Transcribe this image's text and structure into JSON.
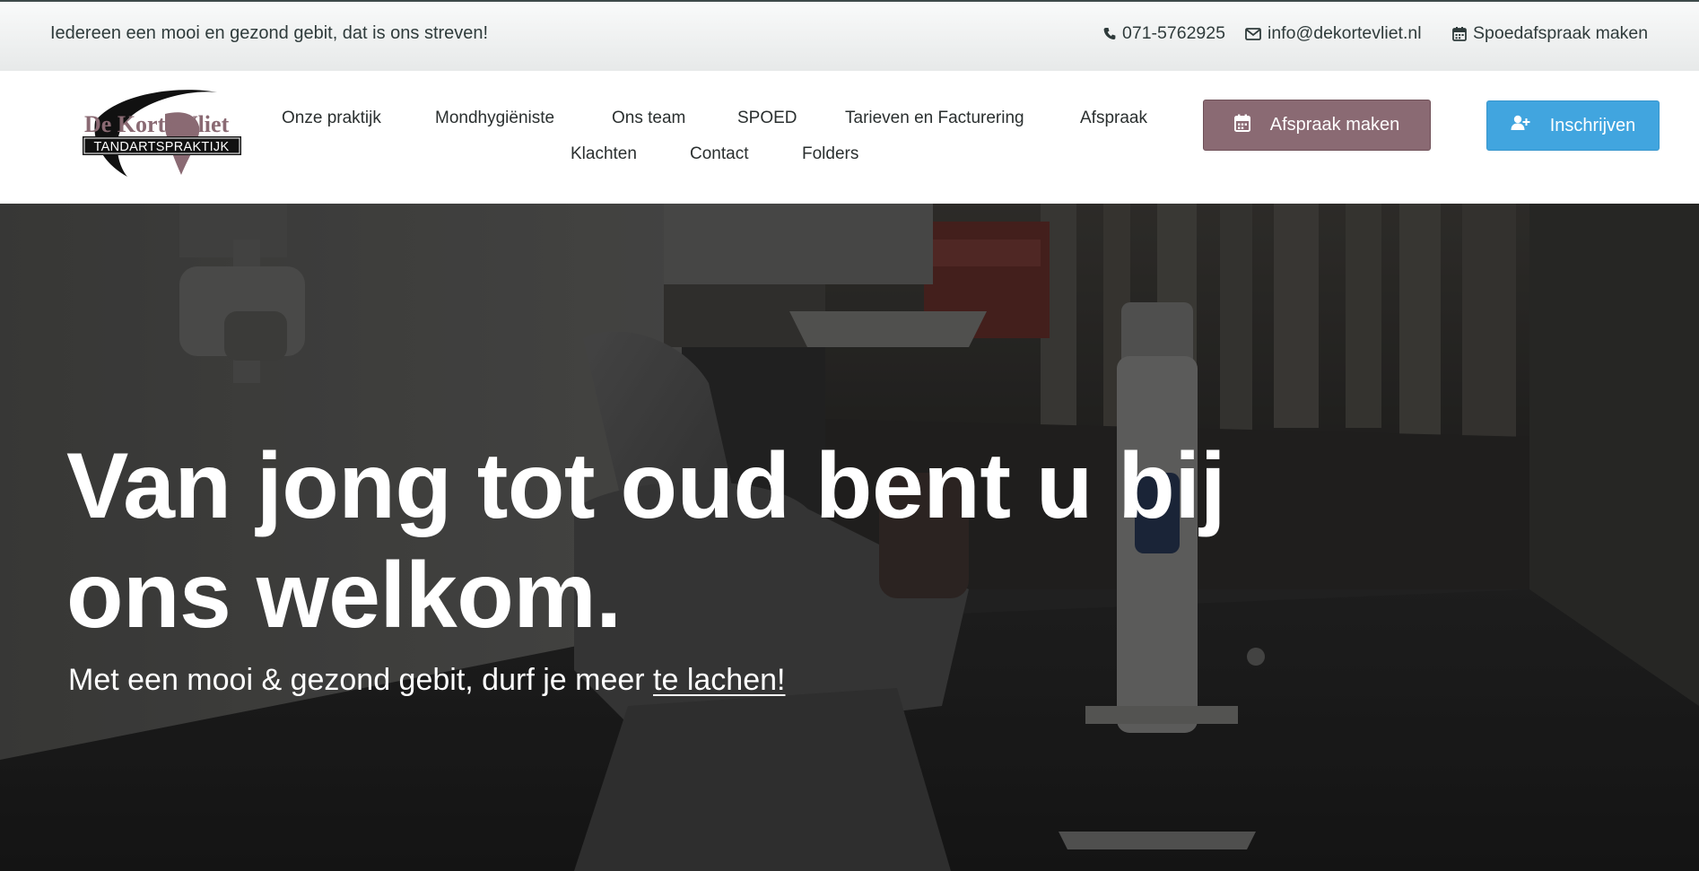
{
  "topbar": {
    "tagline": "Iedereen een mooi en gezond gebit, dat is ons streven!",
    "phone": "071-5762925",
    "email": "info@dekortevliet.nl",
    "spoed": "Spoedafspraak maken"
  },
  "logo": {
    "name": "De Korte Vliet",
    "subtitle": "TANDARTSPRAKTIJK"
  },
  "nav": {
    "items": [
      "Onze praktijk",
      "Mondhygiëniste",
      "Ons team",
      "SPOED",
      "Tarieven en Facturering",
      "Afspraak",
      "Klachten",
      "Contact",
      "Folders"
    ]
  },
  "buttons": {
    "afspraak": "Afspraak maken",
    "inschrijven": "Inschrijven"
  },
  "hero": {
    "title": "Van jong tot oud bent u bij ons welkom.",
    "subtitle_pre": "Met een mooi & gezond gebit, durf je meer ",
    "subtitle_link": "te lachen!"
  },
  "colors": {
    "accent_mauve": "#8a6a73",
    "accent_blue": "#41a5df",
    "text_dark": "#2f3b3b"
  },
  "icons": {
    "phone": "phone-icon",
    "email": "envelope-icon",
    "spoed": "calendar-icon",
    "afspraak": "calendar-icon",
    "inschrijven": "user-plus-icon"
  }
}
